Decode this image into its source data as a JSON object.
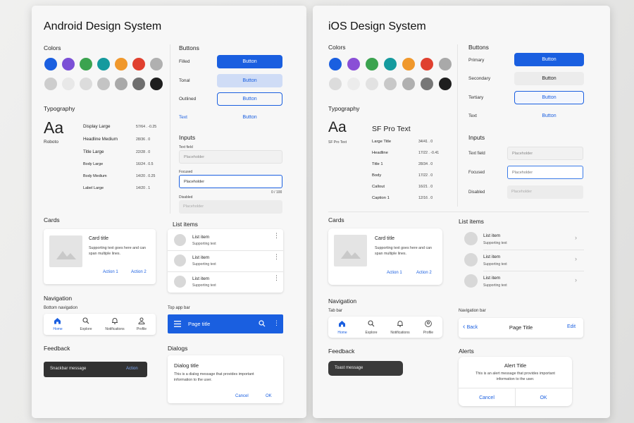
{
  "android": {
    "title": "Android Design System",
    "colors_label": "Colors",
    "accent_colors": [
      "#1a5fe0",
      "#7b4fd6",
      "#3ba34f",
      "#159a9e",
      "#f0982c",
      "#e0402f",
      "#b0b0b0"
    ],
    "neutral_colors": [
      "#cdcdcd",
      "#e8e8e8",
      "#dcdcdc",
      "#c4c4c4",
      "#a9a9a9",
      "#6f6f6f",
      "#1e1e1e"
    ],
    "buttons_label": "Buttons",
    "buttons": [
      {
        "label": "Filled",
        "button": "Button"
      },
      {
        "label": "Tonal",
        "button": "Button"
      },
      {
        "label": "Outlined",
        "button": "Button"
      },
      {
        "label": "Text",
        "button": "Button"
      }
    ],
    "typography_label": "Typography",
    "typeface_sample": "Aa",
    "typeface_name": "Roboto",
    "type_scale": [
      {
        "name": "Display Large",
        "spec": "57/64 . -0.25"
      },
      {
        "name": "Headline Medium",
        "spec": "28/36 . 0"
      },
      {
        "name": "Title Large",
        "spec": "22/28 . 0"
      },
      {
        "name": "Body Large",
        "spec": "16/24 . 0.5"
      },
      {
        "name": "Body Medium",
        "spec": "14/20 . 0.25"
      },
      {
        "name": "Label Large",
        "spec": "14/20 . 1"
      }
    ],
    "inputs_label": "Inputs",
    "inputs": {
      "text_field_label": "Text field",
      "text_field_placeholder": "Placeholder",
      "focused_label": "Focused",
      "focused_placeholder": "Placeholder",
      "focused_counter": "0 / 100",
      "disabled_label": "Disabled",
      "disabled_placeholder": "Placeholder"
    },
    "cards_label": "Cards",
    "card": {
      "title": "Card title",
      "text": "Supporting text goes here and can span multiple lines.",
      "action1": "Action 1",
      "action2": "Action 2"
    },
    "list_label": "List items",
    "list": [
      {
        "title": "List item",
        "sub": "Supporting text"
      },
      {
        "title": "List item",
        "sub": "Supporting text"
      },
      {
        "title": "List item",
        "sub": "Supporting text"
      }
    ],
    "navigation_label": "Navigation",
    "bottom_nav_label": "Bottom navigation",
    "bottom_nav": [
      "Home",
      "Explore",
      "Notifications",
      "Profile"
    ],
    "top_app_bar_label": "Top app bar",
    "top_app_bar_title": "Page title",
    "feedback_label": "Feedback",
    "snackbar_message": "Snackbar message",
    "snackbar_action": "Action",
    "dialogs_label": "Dialogs",
    "dialog": {
      "title": "Dialog title",
      "text": "This is a dialog message that provides important information to the user.",
      "cancel": "Cancel",
      "ok": "OK"
    }
  },
  "ios": {
    "title": "iOS Design System",
    "colors_label": "Colors",
    "accent_colors": [
      "#1a5fe0",
      "#8a4fd6",
      "#3ba34f",
      "#159a9e",
      "#f0982c",
      "#e0402f",
      "#a9a9a9"
    ],
    "neutral_colors": [
      "#dcdcdc",
      "#ececec",
      "#e2e2e2",
      "#c8c8c8",
      "#b0b0b0",
      "#777777",
      "#1e1e1e"
    ],
    "buttons_label": "Buttons",
    "buttons": [
      {
        "label": "Primary",
        "button": "Button"
      },
      {
        "label": "Secondary",
        "button": "Button"
      },
      {
        "label": "Tertiary",
        "button": "Button"
      },
      {
        "label": "Text",
        "button": "Button"
      }
    ],
    "typography_label": "Typography",
    "typeface_sample": "Aa",
    "typeface_name": "SF Pro Text",
    "typeface_heading": "SF Pro Text",
    "type_scale": [
      {
        "name": "Large Title",
        "spec": "34/41 . 0"
      },
      {
        "name": "Headline",
        "spec": "17/22 . -0.41"
      },
      {
        "name": "Title 1",
        "spec": "28/34 . 0"
      },
      {
        "name": "Body",
        "spec": "17/22 . 0"
      },
      {
        "name": "Callout",
        "spec": "16/21 . 0"
      },
      {
        "name": "Caption 1",
        "spec": "12/16 . 0"
      }
    ],
    "inputs_label": "Inputs",
    "inputs": {
      "text_field_label": "Text field",
      "text_field_placeholder": "Placeholder",
      "focused_label": "Focused",
      "focused_placeholder": "Placeholder",
      "disabled_label": "Disabled",
      "disabled_placeholder": "Placeholder"
    },
    "cards_label": "Cards",
    "card": {
      "title": "Card title",
      "text": "Supporting text goes here and can span multiple lines.",
      "action1": "Action 1",
      "action2": "Action 2"
    },
    "list_label": "List items",
    "list": [
      {
        "title": "List item",
        "sub": "Supporting text"
      },
      {
        "title": "List item",
        "sub": "Supporting text"
      },
      {
        "title": "List item",
        "sub": "Supporting text"
      }
    ],
    "navigation_label": "Navigation",
    "tab_bar_label": "Tab bar",
    "tab_bar": [
      "Home",
      "Explore",
      "Notifications",
      "Profile"
    ],
    "nav_bar_label": "Navigation bar",
    "nav_bar": {
      "back": "Back",
      "title": "Page Title",
      "edit": "Edit"
    },
    "feedback_label": "Feedback",
    "toast_message": "Toast message",
    "alerts_label": "Alerts",
    "alert": {
      "title": "Alert Title",
      "text": "This is an alert message that provides important information to the user.",
      "cancel": "Cancel",
      "ok": "OK"
    }
  }
}
